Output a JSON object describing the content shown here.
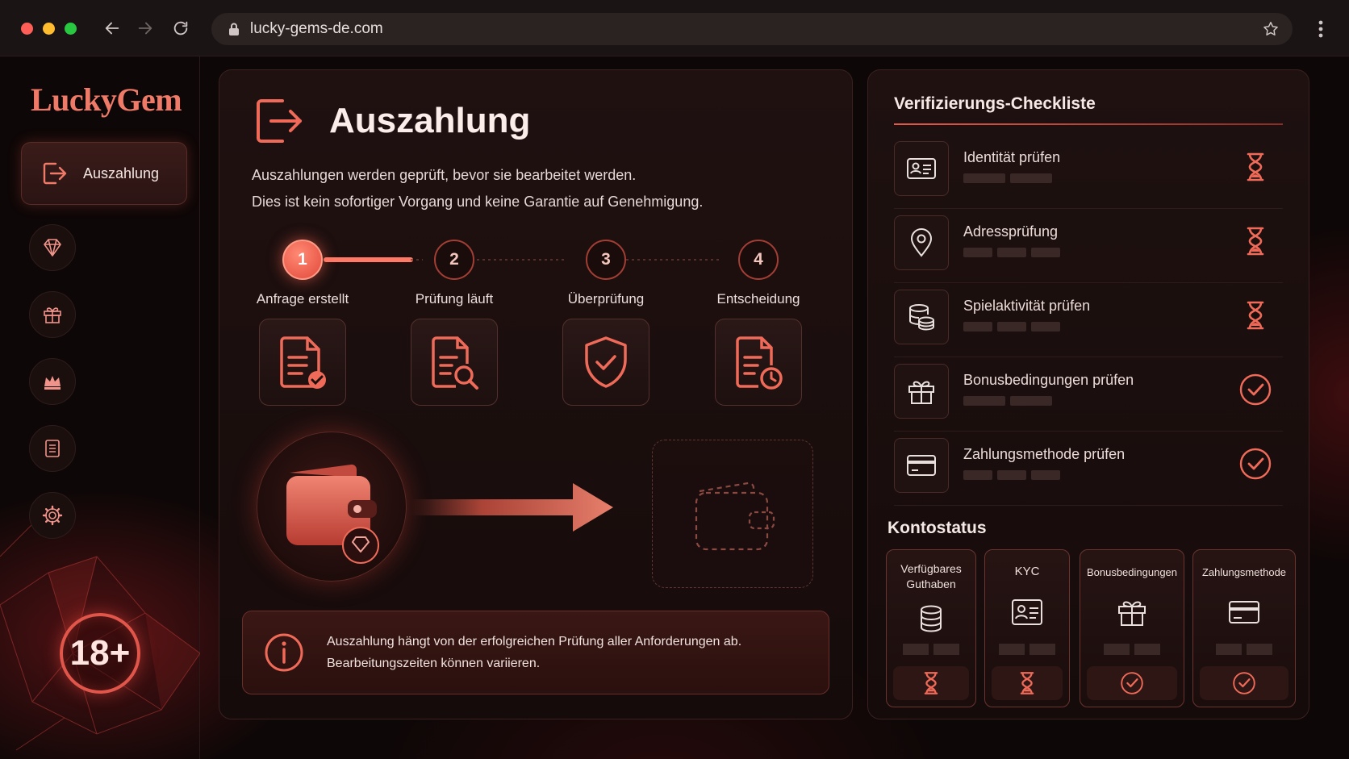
{
  "browser": {
    "url": "lucky-gems-de.com"
  },
  "sidebar": {
    "logo": "LuckyGem",
    "active_item": {
      "label": "Auszahlung",
      "icon": "exit-arrow-icon"
    },
    "icons": [
      "diamond-icon",
      "gift-icon",
      "crown-icon",
      "document-icon",
      "gear-icon"
    ],
    "age_badge": "18+"
  },
  "main": {
    "title": "Auszahlung",
    "description_line1": "Auszahlungen werden geprüft, bevor sie bearbeitet werden.",
    "description_line2": "Dies ist kein sofortiger Vorgang und keine Garantie auf Genehmigung.",
    "steps": [
      {
        "number": "1",
        "label": "Anfrage erstellt",
        "icon": "document-check-icon",
        "active": true
      },
      {
        "number": "2",
        "label": "Prüfung läuft",
        "icon": "document-search-icon",
        "active": false
      },
      {
        "number": "3",
        "label": "Überprüfung",
        "icon": "shield-check-icon",
        "active": false
      },
      {
        "number": "4",
        "label": "Entscheidung",
        "icon": "document-clock-icon",
        "active": false
      }
    ],
    "progress_fraction": 0.17,
    "info_line1": "Auszahlung hängt von der erfolgreichen Prüfung aller Anforderungen ab.",
    "info_line2": "Bearbeitungszeiten können variieren."
  },
  "checklist": {
    "title": "Verifizierungs-Checkliste",
    "items": [
      {
        "label": "Identität prüfen",
        "icon": "id-card-icon",
        "status": "pending"
      },
      {
        "label": "Adressprüfung",
        "icon": "location-pin-icon",
        "status": "pending"
      },
      {
        "label": "Spielaktivität prüfen",
        "icon": "coin-stack-icon",
        "status": "pending"
      },
      {
        "label": "Bonusbedingungen prüfen",
        "icon": "gift-icon",
        "status": "done"
      },
      {
        "label": "Zahlungsmethode prüfen",
        "icon": "credit-card-icon",
        "status": "done"
      }
    ]
  },
  "kontostatus": {
    "title": "Kontostatus",
    "cards": [
      {
        "label_line1": "Verfügbares",
        "label_line2": "Guthaben",
        "icon": "coin-stack-icon",
        "status": "pending"
      },
      {
        "label_line1": "KYC",
        "label_line2": "",
        "icon": "id-card-icon",
        "status": "pending"
      },
      {
        "label_line1": "Bonusbedingungen",
        "label_line2": "",
        "icon": "gift-icon",
        "status": "done"
      },
      {
        "label_line1": "Zahlungsmethode",
        "label_line2": "",
        "icon": "credit-card-icon",
        "status": "done"
      }
    ]
  },
  "colors": {
    "accent": "#e85a48",
    "accent_light": "#ff8a74",
    "background": "#0e0707",
    "panel": "#1c0f0e"
  }
}
